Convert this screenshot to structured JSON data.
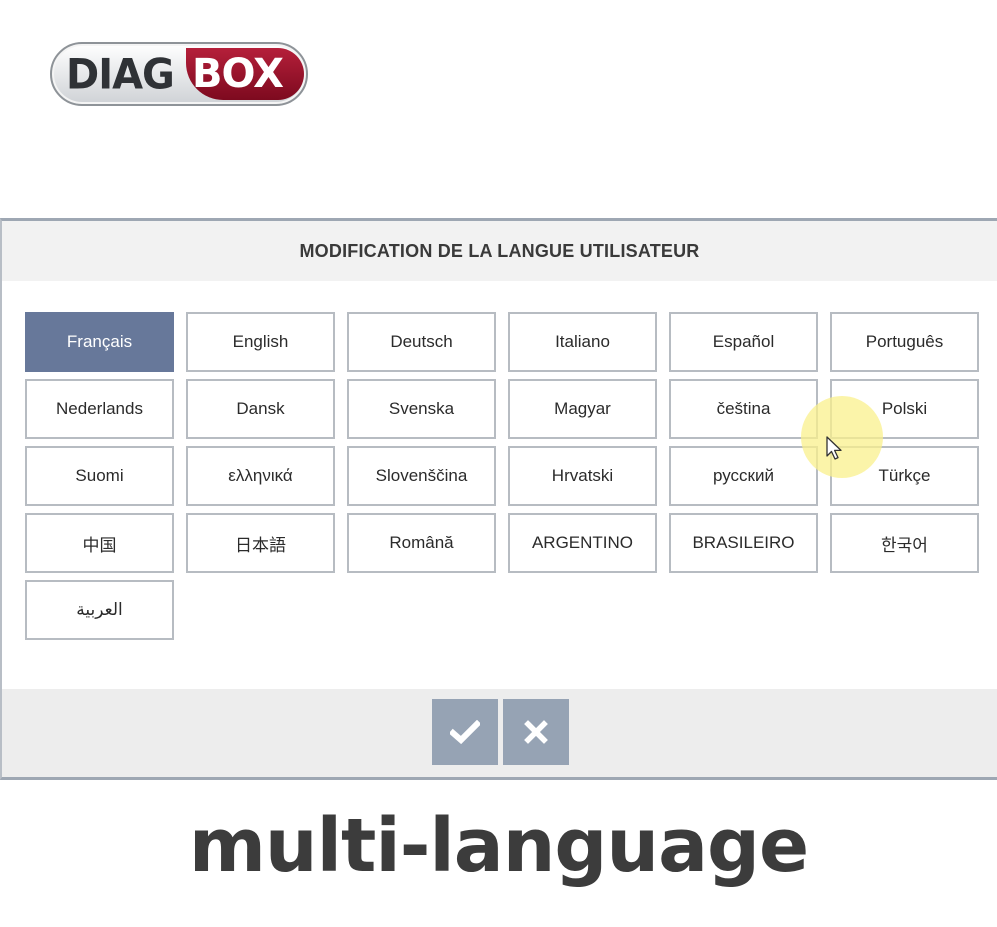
{
  "logo": {
    "part1": "DIAG",
    "part2": "BOX",
    "brand_red": "#9d1330",
    "brand_gray": "#2f3236"
  },
  "dialog": {
    "title": "MODIFICATION DE LA LANGUE UTILISATEUR",
    "selected_language": "Français",
    "languages": [
      "Français",
      "English",
      "Deutsch",
      "Italiano",
      "Español",
      "Português",
      "Nederlands",
      "Dansk",
      "Svenska",
      "Magyar",
      "čeština",
      "Polski",
      "Suomi",
      "ελληνικά",
      "Slovenščina",
      "Hrvatski",
      "русский",
      "Türkçe",
      "中国",
      "日本語",
      "Română",
      "ARGENTINO",
      "BRASILEIRO",
      "한국어",
      "العربية"
    ],
    "ok_icon": "check-icon",
    "cancel_icon": "close-icon",
    "selected_color": "#67789a",
    "action_color": "#96a3b4"
  },
  "caption": "multi-language"
}
